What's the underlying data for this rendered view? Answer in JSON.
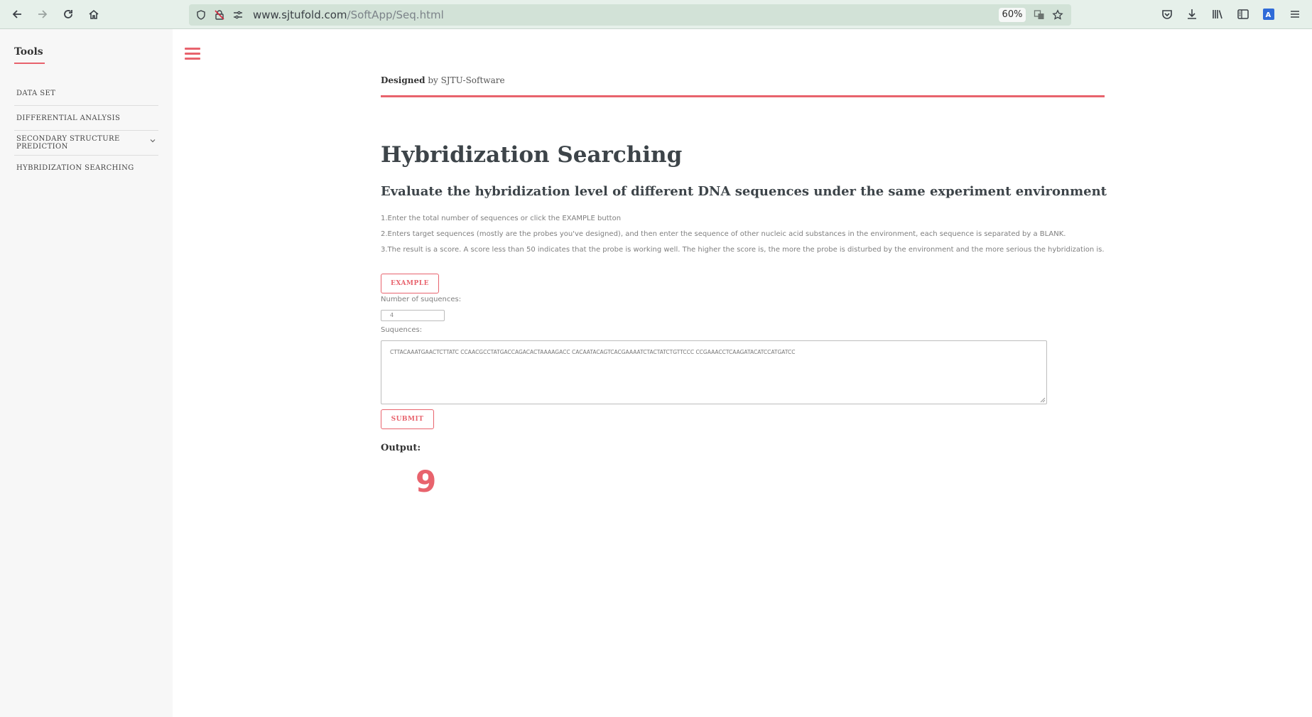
{
  "browser": {
    "url_host": "www.sjtufold.com",
    "url_path": "/SoftApp/Seq.html",
    "zoom": "60%"
  },
  "sidebar": {
    "title": "Tools",
    "items": [
      {
        "label": "DATA SET"
      },
      {
        "label": "DIFFERENTIAL ANALYSIS"
      },
      {
        "label": "SECONDARY STRUCTURE PREDICTION"
      },
      {
        "label": "HYBRIDIZATION SEARCHING"
      }
    ]
  },
  "main": {
    "designed_bold": "Designed",
    "designed_rest": " by SJTU-Software",
    "title": "Hybridization Searching",
    "subtitle": "Evaluate the hybridization level of different DNA sequences under the same experiment environment",
    "instructions": [
      "1.Enter the total number of sequences or click the EXAMPLE button",
      "2.Enters target sequences (mostly are the probes you've designed), and then enter the sequence of other nucleic acid substances in the environment, each sequence is separated by a BLANK.",
      "3.The result is a score. A score less than 50 indicates that the probe is working well. The higher the score is, the more the probe is disturbed by the environment and the more serious the hybridization is."
    ],
    "example_button": "EXAMPLE",
    "num_label": "Number of suquences:",
    "num_value": "4",
    "seq_label": "Suquences:",
    "seq_value": "CTTACAAATGAACTCTTATC CCAACGCCTATGACCAGACACTAAAAGACC CACAATACAGTCACGAAAATCTACTATCTGTTCCC CCGAAACCTCAAGATACATCCATGATCC",
    "submit_button": "SUBMIT",
    "output_label": "Output:",
    "output_value": "9"
  },
  "colors": {
    "accent": "#e8636d",
    "chrome": "#e6f0ea"
  }
}
